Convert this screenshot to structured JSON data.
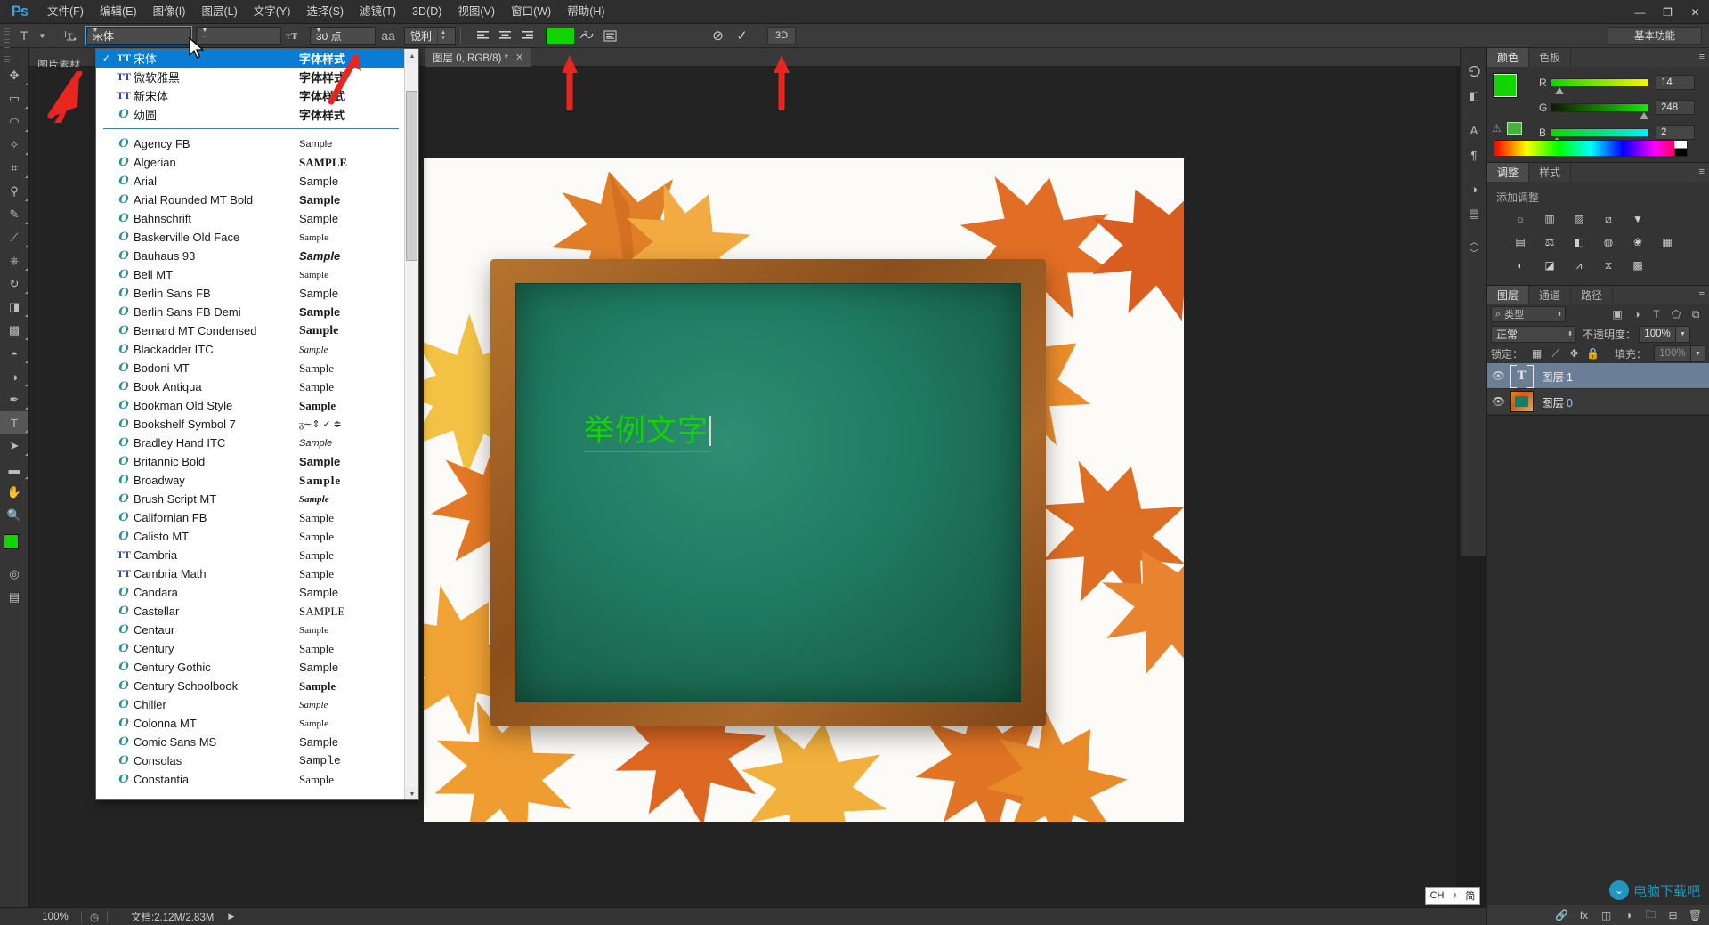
{
  "app": {
    "logo": "Ps",
    "menus": [
      {
        "label": "文件(F)"
      },
      {
        "label": "编辑(E)"
      },
      {
        "label": "图像(I)"
      },
      {
        "label": "图层(L)"
      },
      {
        "label": "文字(Y)"
      },
      {
        "label": "选择(S)"
      },
      {
        "label": "滤镜(T)"
      },
      {
        "label": "3D(D)"
      },
      {
        "label": "视图(V)"
      },
      {
        "label": "窗口(W)"
      },
      {
        "label": "帮助(H)"
      }
    ],
    "window_controls": {
      "minimize": "—",
      "maximize": "❐",
      "close": "✕"
    }
  },
  "options_bar": {
    "tool_icon": "T",
    "orientation_icon": "text-orientation-icon",
    "font_family": "宋体",
    "font_style": "-",
    "size_icon": "TT",
    "font_size": "30 点",
    "aa_icon": "aa",
    "anti_alias": "锐利",
    "align": [
      "align-left",
      "align-center",
      "align-right"
    ],
    "color_swatch": "#12d400",
    "warp_icon": "warp-text-icon",
    "panel_toggle_icon": "character-panel-icon",
    "cancel_icon": "⊘",
    "commit_icon": "✓",
    "btn_3d": "3D",
    "workspace": "基本功能"
  },
  "document_tab": {
    "label": "图层 0, RGB/8) *",
    "close": "✕"
  },
  "hint_text": "图片素材",
  "font_menu": {
    "recent": [
      {
        "icon": "TT",
        "icon_type": "ttf",
        "name": "宋体",
        "sample": "字体样式",
        "sample_class": "s-sans s-bold",
        "selected": true,
        "checked": true
      },
      {
        "icon": "TT",
        "icon_type": "ttf",
        "name": "微软雅黑",
        "sample": "字体样式",
        "sample_class": "s-sans s-bold",
        "selected": false,
        "checked": false
      },
      {
        "icon": "TT",
        "icon_type": "ttf",
        "name": "新宋体",
        "sample": "字体样式",
        "sample_class": "s-sans s-bold",
        "selected": false,
        "checked": false
      },
      {
        "icon": "O",
        "icon_type": "otf",
        "name": "幼圆",
        "sample": "字体样式",
        "sample_class": "s-sans s-bold",
        "selected": false,
        "checked": false
      }
    ],
    "fonts": [
      {
        "icon": "O",
        "icon_type": "otf",
        "name": "Agency FB",
        "sample": "Sample",
        "sample_class": "s-sans s-small"
      },
      {
        "icon": "O",
        "icon_type": "otf",
        "name": "Algerian",
        "sample": "SAMPLE",
        "sample_class": "s-serif s-bold"
      },
      {
        "icon": "O",
        "icon_type": "otf",
        "name": "Arial",
        "sample": "Sample",
        "sample_class": "s-sans"
      },
      {
        "icon": "O",
        "icon_type": "otf",
        "name": "Arial Rounded MT Bold",
        "sample": "Sample",
        "sample_class": "s-sans s-bold"
      },
      {
        "icon": "O",
        "icon_type": "otf",
        "name": "Bahnschrift",
        "sample": "Sample",
        "sample_class": "s-sans"
      },
      {
        "icon": "O",
        "icon_type": "otf",
        "name": "Baskerville Old Face",
        "sample": "Sample",
        "sample_class": "s-serif s-small"
      },
      {
        "icon": "O",
        "icon_type": "otf",
        "name": "Bauhaus 93",
        "sample": "Sample",
        "sample_class": "s-sans s-bold s-ital"
      },
      {
        "icon": "O",
        "icon_type": "otf",
        "name": "Bell MT",
        "sample": "Sample",
        "sample_class": "s-serif s-small"
      },
      {
        "icon": "O",
        "icon_type": "otf",
        "name": "Berlin Sans FB",
        "sample": "Sample",
        "sample_class": "s-sans"
      },
      {
        "icon": "O",
        "icon_type": "otf",
        "name": "Berlin Sans FB Demi",
        "sample": "Sample",
        "sample_class": "s-sans s-bold"
      },
      {
        "icon": "O",
        "icon_type": "otf",
        "name": "Bernard MT Condensed",
        "sample": "Sample",
        "sample_class": "s-serif s-bold s-big"
      },
      {
        "icon": "O",
        "icon_type": "otf",
        "name": "Blackadder ITC",
        "sample": "Sample",
        "sample_class": "s-serif s-ital s-small"
      },
      {
        "icon": "O",
        "icon_type": "otf",
        "name": "Bodoni MT",
        "sample": "Sample",
        "sample_class": "s-serif"
      },
      {
        "icon": "O",
        "icon_type": "otf",
        "name": "Book Antiqua",
        "sample": "Sample",
        "sample_class": "s-serif"
      },
      {
        "icon": "O",
        "icon_type": "otf",
        "name": "Bookman Old Style",
        "sample": "Sample",
        "sample_class": "s-serif s-bold"
      },
      {
        "icon": "O",
        "icon_type": "otf",
        "name": "Bookshelf Symbol 7",
        "sample": "ᵹ∼⇕ ✓ ≑",
        "sample_class": "s-serif s-small"
      },
      {
        "icon": "O",
        "icon_type": "otf",
        "name": "Bradley Hand ITC",
        "sample": "Sample",
        "sample_class": "s-sans s-ital s-small"
      },
      {
        "icon": "O",
        "icon_type": "otf",
        "name": "Britannic Bold",
        "sample": "Sample",
        "sample_class": "s-sans s-bold"
      },
      {
        "icon": "O",
        "icon_type": "otf",
        "name": "Broadway",
        "sample": "Sample",
        "sample_class": "s-serif s-bold s-wide"
      },
      {
        "icon": "O",
        "icon_type": "otf",
        "name": "Brush Script MT",
        "sample": "Sample",
        "sample_class": "s-serif s-ital s-bold s-small"
      },
      {
        "icon": "O",
        "icon_type": "otf",
        "name": "Californian FB",
        "sample": "Sample",
        "sample_class": "s-serif"
      },
      {
        "icon": "O",
        "icon_type": "otf",
        "name": "Calisto MT",
        "sample": "Sample",
        "sample_class": "s-serif"
      },
      {
        "icon": "TT",
        "icon_type": "ttf",
        "name": "Cambria",
        "sample": "Sample",
        "sample_class": "s-serif"
      },
      {
        "icon": "TT",
        "icon_type": "ttf",
        "name": "Cambria Math",
        "sample": "Sample",
        "sample_class": "s-serif"
      },
      {
        "icon": "O",
        "icon_type": "otf",
        "name": "Candara",
        "sample": "Sample",
        "sample_class": "s-sans"
      },
      {
        "icon": "O",
        "icon_type": "otf",
        "name": "Castellar",
        "sample": "SAMPLE",
        "sample_class": "s-serif"
      },
      {
        "icon": "O",
        "icon_type": "otf",
        "name": "Centaur",
        "sample": "Sample",
        "sample_class": "s-serif s-small"
      },
      {
        "icon": "O",
        "icon_type": "otf",
        "name": "Century",
        "sample": "Sample",
        "sample_class": "s-serif"
      },
      {
        "icon": "O",
        "icon_type": "otf",
        "name": "Century Gothic",
        "sample": "Sample",
        "sample_class": "s-sans"
      },
      {
        "icon": "O",
        "icon_type": "otf",
        "name": "Century Schoolbook",
        "sample": "Sample",
        "sample_class": "s-serif s-bold"
      },
      {
        "icon": "O",
        "icon_type": "otf",
        "name": "Chiller",
        "sample": "Sample",
        "sample_class": "s-serif s-ital s-small"
      },
      {
        "icon": "O",
        "icon_type": "otf",
        "name": "Colonna MT",
        "sample": "Sample",
        "sample_class": "s-serif s-small"
      },
      {
        "icon": "O",
        "icon_type": "otf",
        "name": "Comic Sans MS",
        "sample": "Sample",
        "sample_class": "s-sans"
      },
      {
        "icon": "O",
        "icon_type": "otf",
        "name": "Consolas",
        "sample": "Sample",
        "sample_class": "s-mono"
      },
      {
        "icon": "O",
        "icon_type": "otf",
        "name": "Constantia",
        "sample": "Sample",
        "sample_class": "s-serif"
      }
    ]
  },
  "canvas": {
    "text": "举例文字",
    "text_color": "#12d400"
  },
  "color_panel": {
    "tabs": [
      {
        "label": "颜色",
        "active": true
      },
      {
        "label": "色板",
        "active": false
      }
    ],
    "foreground": "#12d400",
    "background": "#e4b6e8",
    "channels": [
      {
        "label": "R",
        "value": "14"
      },
      {
        "label": "G",
        "value": "248"
      },
      {
        "label": "B",
        "value": "2"
      }
    ],
    "warning_icon": "gamut-warning-icon"
  },
  "adjustments_panel": {
    "tabs": [
      {
        "label": "调整",
        "active": true
      },
      {
        "label": "样式",
        "active": false
      }
    ],
    "title": "添加调整",
    "rows": [
      [
        "brightness-contrast-icon",
        "levels-icon",
        "curves-icon",
        "exposure-icon",
        "vibrance-icon"
      ],
      [
        "hue-saturation-icon",
        "color-balance-icon",
        "black-white-icon",
        "photo-filter-icon",
        "channel-mixer-icon",
        "color-lookup-icon"
      ],
      [
        "invert-icon",
        "posterize-icon",
        "threshold-icon",
        "selective-color-icon",
        "gradient-map-icon"
      ]
    ]
  },
  "layers_panel": {
    "tabs": [
      {
        "label": "图层",
        "active": true
      },
      {
        "label": "通道",
        "active": false
      },
      {
        "label": "路径",
        "active": false
      }
    ],
    "filter": {
      "label": "类型",
      "icons": [
        "pixel-filter-icon",
        "adjustment-filter-icon",
        "type-filter-icon",
        "shape-filter-icon",
        "smart-object-filter-icon"
      ]
    },
    "blend_mode": "正常",
    "opacity_label": "不透明度：",
    "opacity_value": "100%",
    "lock_label": "锁定：",
    "lock_icons": [
      "lock-transparent-icon",
      "lock-image-icon",
      "lock-position-icon",
      "lock-all-icon"
    ],
    "fill_label": "填充：",
    "fill_value": "100%",
    "layers": [
      {
        "name": "图层",
        "number": "1",
        "type": "text",
        "visible": true,
        "selected": true
      },
      {
        "name": "图层",
        "number": "0",
        "type": "image",
        "visible": true,
        "selected": false
      }
    ],
    "footer_icons": [
      "link-layers-icon",
      "layer-style-icon",
      "layer-mask-icon",
      "new-group-icon",
      "new-layer-icon",
      "delete-layer-icon"
    ]
  },
  "status_bar": {
    "zoom": "100%",
    "doc_icon": "document-info-icon",
    "doc_size": "文档:2.12M/2.83M",
    "expand": "▶"
  },
  "ime": {
    "lang": "CH",
    "mode_icon": "♪",
    "script": "简"
  },
  "watermark": {
    "mark": "⬤",
    "text": "电脑下载吧"
  },
  "mini_rail_icons": [
    "history-icon",
    "color-mini-icon",
    "swatch-mini-icon",
    "character-mini-icon",
    "paragraph-mini-icon",
    "adjust-mini-icon",
    "style-mini-icon",
    "path-mini-icon"
  ],
  "tools": [
    {
      "name": "move-tool",
      "glyph": "✥"
    },
    {
      "name": "marquee-tool",
      "glyph": "▭"
    },
    {
      "name": "lasso-tool",
      "glyph": "◠"
    },
    {
      "name": "quick-select-tool",
      "glyph": "✧"
    },
    {
      "name": "crop-tool",
      "glyph": "⊹"
    },
    {
      "name": "eyedropper-tool",
      "glyph": "⚲"
    },
    {
      "name": "healing-brush-tool",
      "glyph": "✎"
    },
    {
      "name": "brush-tool",
      "glyph": "🖌"
    },
    {
      "name": "clone-stamp-tool",
      "glyph": "⎈"
    },
    {
      "name": "history-brush-tool",
      "glyph": "↺"
    },
    {
      "name": "eraser-tool",
      "glyph": "◧"
    },
    {
      "name": "gradient-tool",
      "glyph": "▦"
    },
    {
      "name": "blur-tool",
      "glyph": "💧"
    },
    {
      "name": "dodge-tool",
      "glyph": "◐"
    },
    {
      "name": "pen-tool",
      "glyph": "✒"
    },
    {
      "name": "type-tool",
      "glyph": "T"
    },
    {
      "name": "path-select-tool",
      "glyph": "➤"
    },
    {
      "name": "shape-tool",
      "glyph": "▬"
    },
    {
      "name": "hand-tool",
      "glyph": "✋"
    },
    {
      "name": "zoom-tool",
      "glyph": "🔍"
    }
  ]
}
